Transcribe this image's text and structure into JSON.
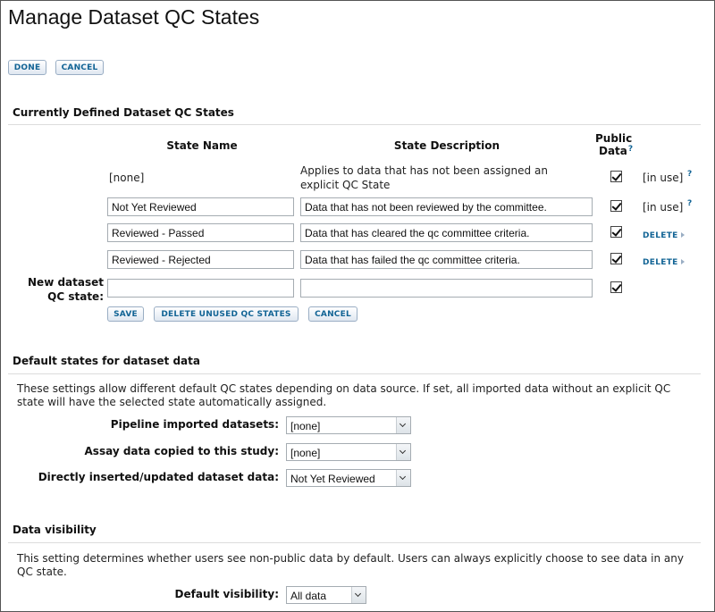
{
  "page": {
    "title": "Manage Dataset QC States"
  },
  "top_buttons": {
    "done": "DONE",
    "cancel": "CANCEL"
  },
  "qc_states": {
    "section_title": "Currently Defined Dataset QC States",
    "headers": {
      "state_name": "State Name",
      "state_description": "State Description",
      "public_line1": "Public",
      "public_line2": "Data",
      "help_mark": "?"
    },
    "none_row": {
      "name": "[none]",
      "description": "Applies to data that has not been assigned an explicit QC State",
      "public": true,
      "status": "[in use]",
      "help_mark": "?"
    },
    "rows": [
      {
        "name": "Not Yet Reviewed",
        "description": "Data that has not been reviewed by the committee.",
        "public": true,
        "status": "[in use]",
        "help_mark": "?"
      },
      {
        "name": "Reviewed - Passed",
        "description": "Data that has cleared the qc committee criteria.",
        "public": true,
        "action": "DELETE"
      },
      {
        "name": "Reviewed - Rejected",
        "description": "Data that has failed the qc committee criteria.",
        "public": true,
        "action": "DELETE"
      }
    ],
    "new_state": {
      "label_line1": "New dataset",
      "label_line2": "QC state:",
      "name": "",
      "description": "",
      "public": true
    },
    "buttons": {
      "save": "SAVE",
      "delete_unused": "DELETE UNUSED QC STATES",
      "cancel": "CANCEL"
    }
  },
  "defaults": {
    "section_title": "Default states for dataset data",
    "description": "These settings allow different default QC states depending on data source. If set, all imported data without an explicit QC state will have the selected state automatically assigned.",
    "pipeline": {
      "label": "Pipeline imported datasets:",
      "value": "[none]"
    },
    "assay": {
      "label": "Assay data copied to this study:",
      "value": "[none]"
    },
    "direct": {
      "label": "Directly inserted/updated dataset data:",
      "value": "Not Yet Reviewed"
    }
  },
  "visibility": {
    "section_title": "Data visibility",
    "description": "This setting determines whether users see non-public data by default. Users can always explicitly choose to see data in any QC state.",
    "default": {
      "label": "Default visibility:",
      "value": "All data"
    }
  }
}
